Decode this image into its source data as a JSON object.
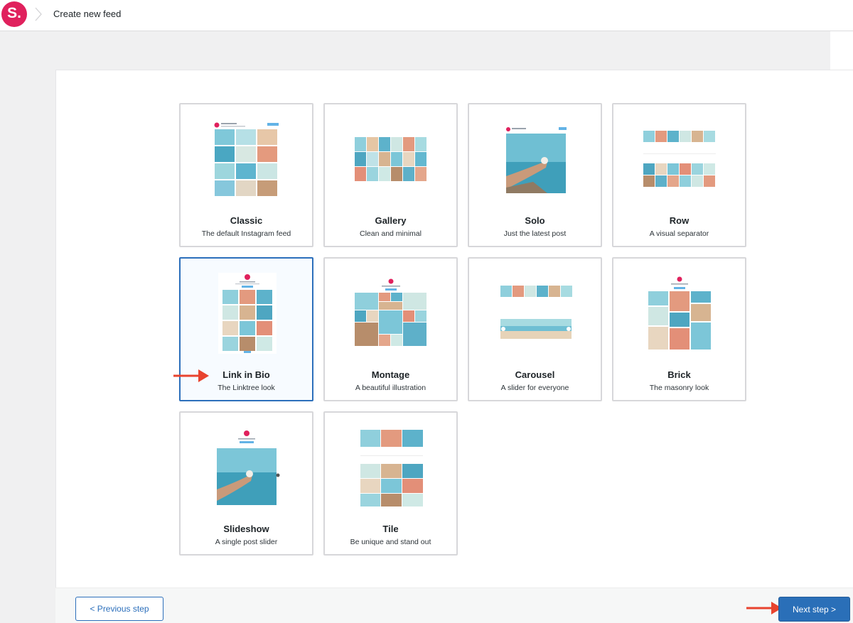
{
  "header": {
    "logo_text": "S.",
    "breadcrumb": "Create new feed"
  },
  "layouts": [
    {
      "title": "Classic",
      "description": "The default Instagram feed"
    },
    {
      "title": "Gallery",
      "description": "Clean and minimal"
    },
    {
      "title": "Solo",
      "description": "Just the latest post"
    },
    {
      "title": "Row",
      "description": "A visual separator"
    },
    {
      "title": "Link in Bio",
      "description": "The Linktree look"
    },
    {
      "title": "Montage",
      "description": "A beautiful illustration"
    },
    {
      "title": "Carousel",
      "description": "A slider for everyone"
    },
    {
      "title": "Brick",
      "description": "The masonry look"
    },
    {
      "title": "Slideshow",
      "description": "A single post slider"
    },
    {
      "title": "Tile",
      "description": "Be unique and stand out"
    }
  ],
  "selected_layout": "Link in Bio",
  "footer": {
    "previous_label": "< Previous step",
    "next_label": "Next step >"
  },
  "colors": {
    "brand": "#e0215d",
    "accent": "#2a6fb8",
    "arrow": "#e8432e"
  }
}
